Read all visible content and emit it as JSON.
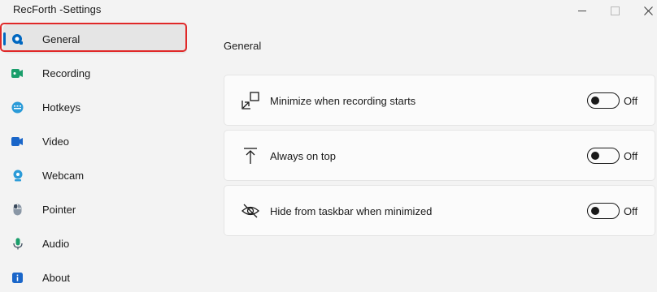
{
  "window": {
    "title": "RecForth -Settings"
  },
  "sidebar": {
    "items": [
      {
        "label": "General",
        "icon": "general-settings-icon"
      },
      {
        "label": "Recording",
        "icon": "recording-camera-icon"
      },
      {
        "label": "Hotkeys",
        "icon": "keyboard-icon"
      },
      {
        "label": "Video",
        "icon": "video-icon"
      },
      {
        "label": "Webcam",
        "icon": "webcam-icon"
      },
      {
        "label": "Pointer",
        "icon": "mouse-pointer-icon"
      },
      {
        "label": "Audio",
        "icon": "microphone-icon"
      },
      {
        "label": "About",
        "icon": "info-icon"
      }
    ],
    "selected_index": 0
  },
  "main": {
    "section_title": "General",
    "settings": [
      {
        "label": "Minimize when recording starts",
        "state": "Off",
        "icon": "minimize-arrows-icon"
      },
      {
        "label": "Always on top",
        "state": "Off",
        "icon": "pin-to-top-icon"
      },
      {
        "label": "Hide from taskbar when minimized",
        "state": "Off",
        "icon": "eye-hidden-icon"
      }
    ]
  },
  "colors": {
    "accent": "#0067c0",
    "highlight_border": "#e02828",
    "background": "#f3f3f3",
    "card": "#fbfbfb"
  }
}
